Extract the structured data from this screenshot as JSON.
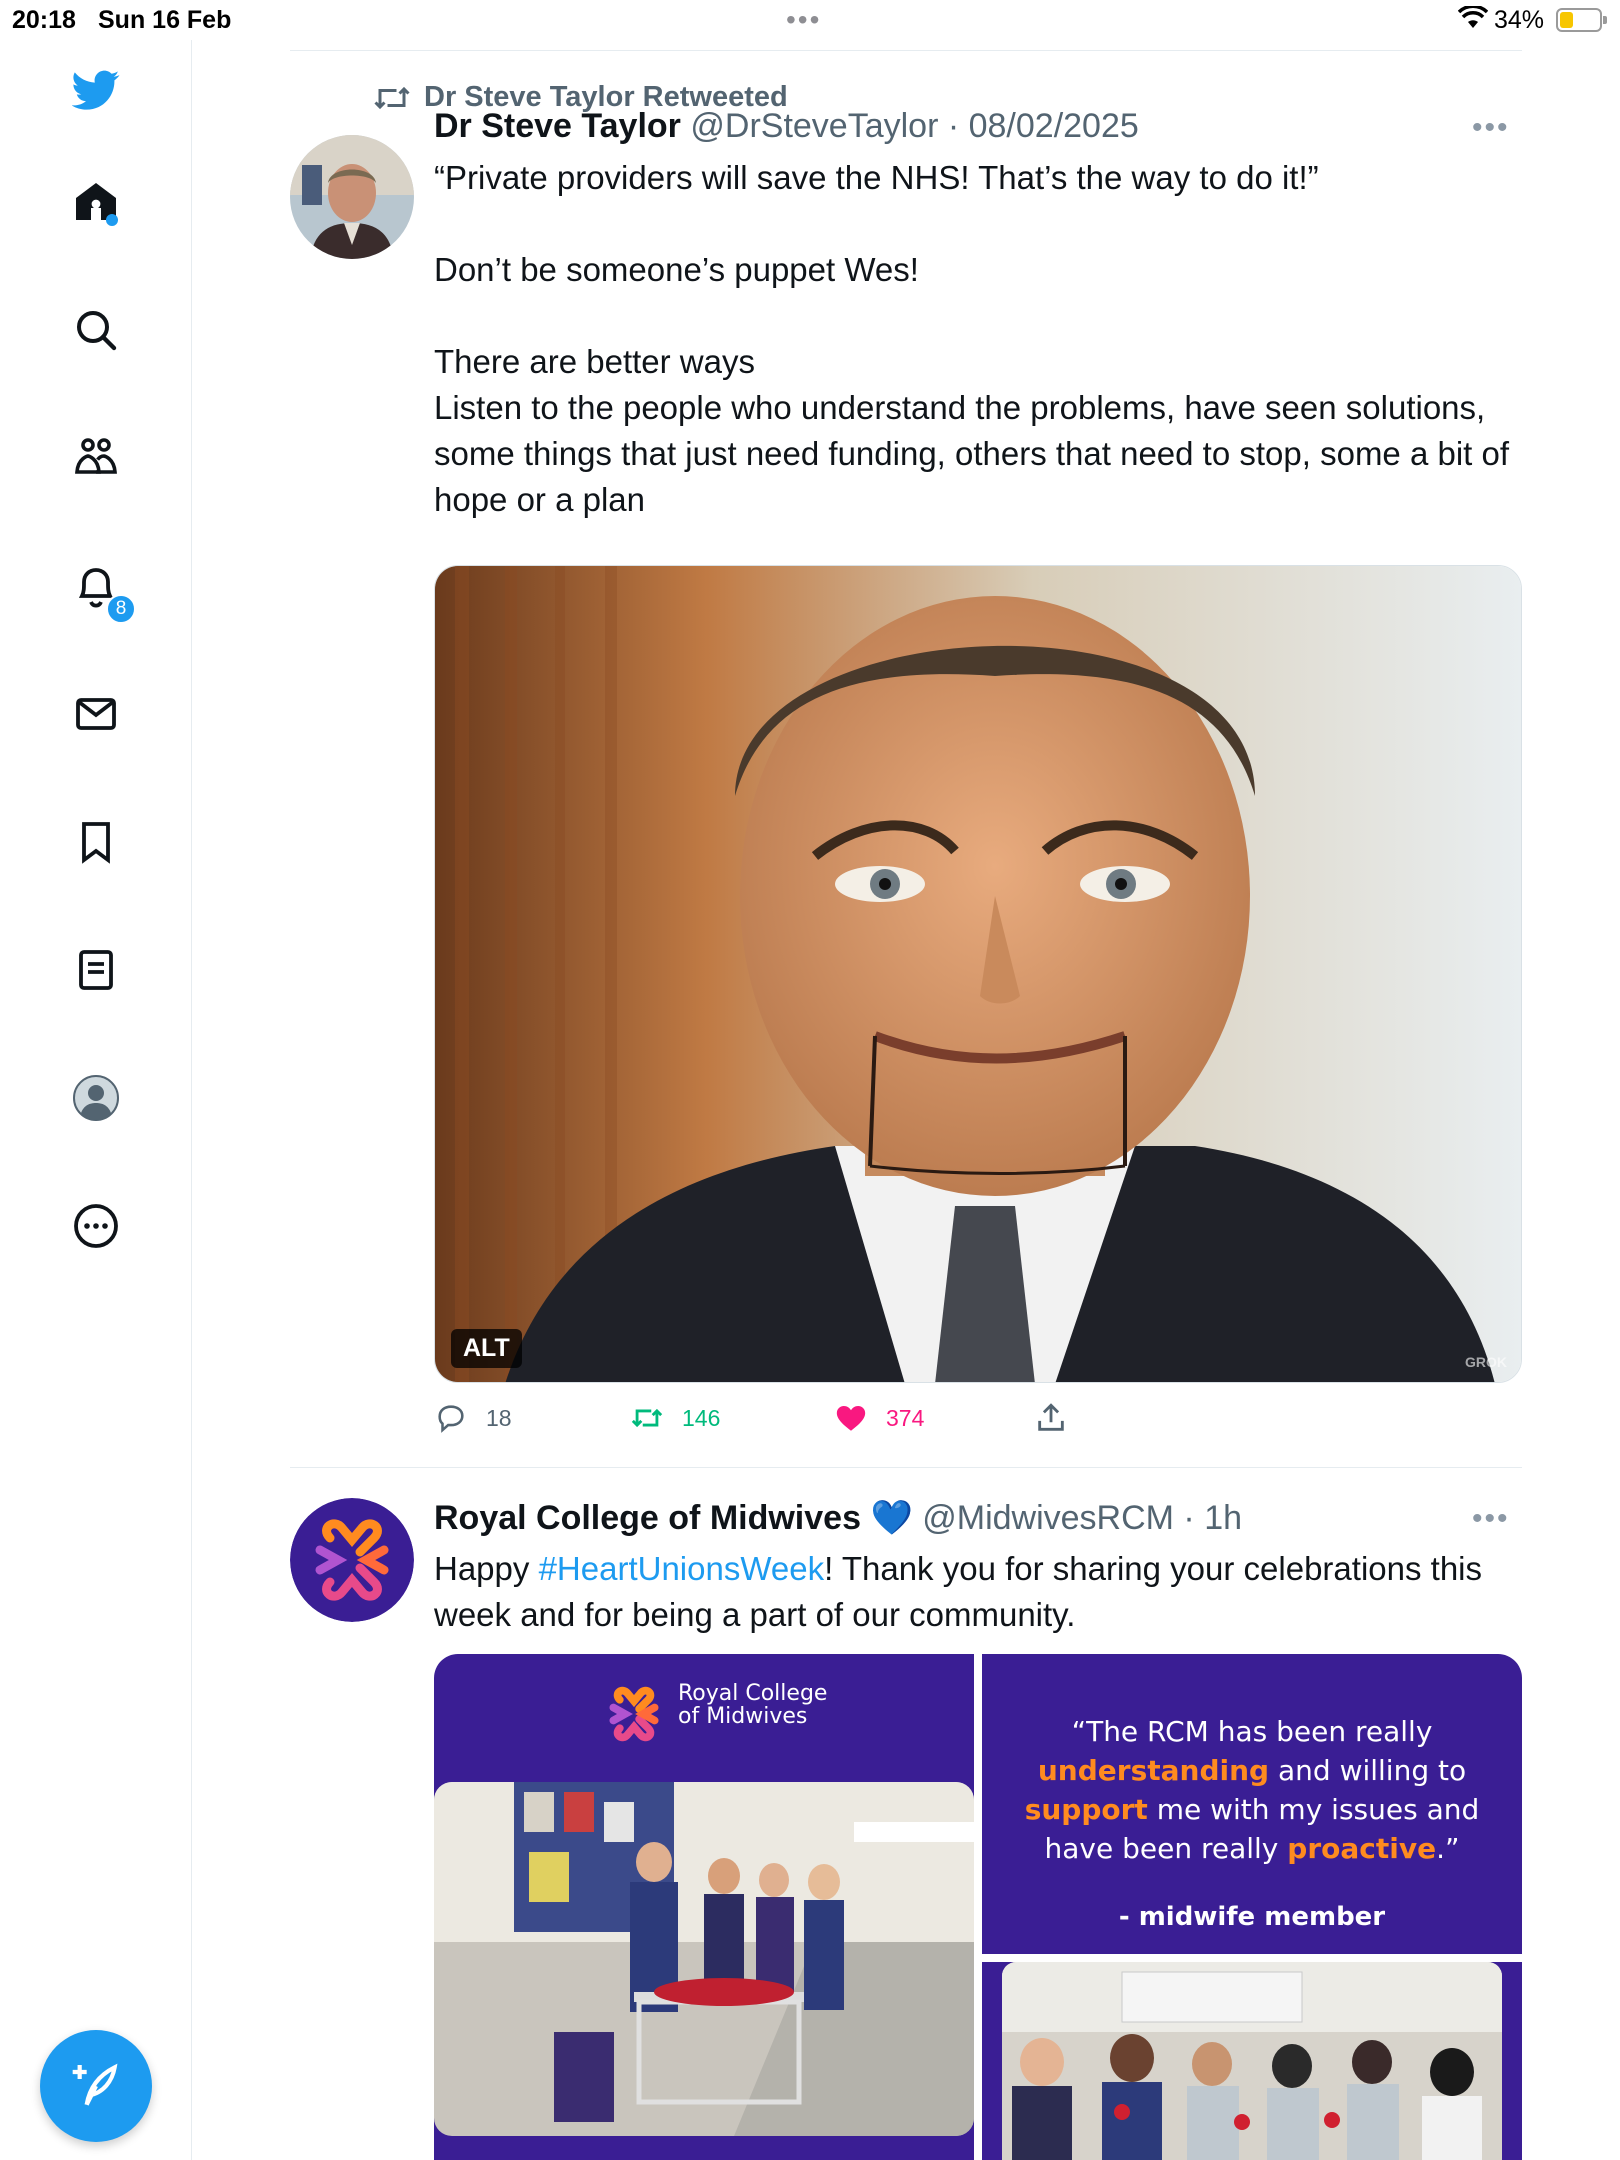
{
  "status_bar": {
    "time": "20:18",
    "date": "Sun 16 Feb",
    "battery_percent": "34%",
    "battery_level": 0.34
  },
  "sidebar": {
    "items": [
      {
        "name": "twitter-logo",
        "icon": "bird-icon"
      },
      {
        "name": "home",
        "icon": "home-icon",
        "has_dot": true
      },
      {
        "name": "explore",
        "icon": "search-icon"
      },
      {
        "name": "communities",
        "icon": "people-icon"
      },
      {
        "name": "notifications",
        "icon": "bell-icon",
        "badge": "8"
      },
      {
        "name": "messages",
        "icon": "envelope-icon"
      },
      {
        "name": "bookmarks",
        "icon": "bookmark-icon"
      },
      {
        "name": "lists",
        "icon": "list-icon"
      },
      {
        "name": "profile",
        "icon": "profile-icon"
      },
      {
        "name": "more",
        "icon": "more-circle-icon"
      }
    ],
    "notification_badge": "8"
  },
  "tweets": [
    {
      "retweeted_by": "Dr Steve Taylor Retweeted",
      "name": "Dr Steve Taylor",
      "handle_date": "@DrSteveTaylor · 08/02/2025",
      "text_lines": [
        "“Private providers will save the NHS! That’s the way to do it!”",
        "Don’t be someone’s puppet Wes!",
        "There are better ways",
        "Listen to the people who understand the problems, have seen solutions, some things that just need funding, others that need to stop, some a bit of hope or a plan"
      ],
      "media_alt_label": "ALT",
      "media_watermark": "GROK",
      "replies": "18",
      "retweets": "146",
      "likes": "374"
    },
    {
      "name": "Royal College of Midwives",
      "verified_emoji": "💙",
      "handle_date": "@MidwivesRCM · 1h",
      "text_prefix": "Happy ",
      "hashtag": "#HeartUnionsWeek",
      "text_suffix": "! Thank you for sharing your celebrations this week and for being a part of our community.",
      "graphic": {
        "logo_line1": "Royal College",
        "logo_line2": "of Midwives",
        "quote_open": "“The RCM has been really ",
        "quote_hl1": "understanding",
        "quote_mid1": " and willing to ",
        "quote_hl2": "support",
        "quote_mid2": " me with my issues and have been really ",
        "quote_hl3": "proactive",
        "quote_close": ".”",
        "signoff": "- midwife member"
      }
    }
  ],
  "colors": {
    "accent": "#1d9bf0",
    "retweet_green": "#00ba7c",
    "like_pink": "#f91880",
    "rcm_purple": "#3a1e94",
    "rcm_orange": "#ff8b1f"
  }
}
